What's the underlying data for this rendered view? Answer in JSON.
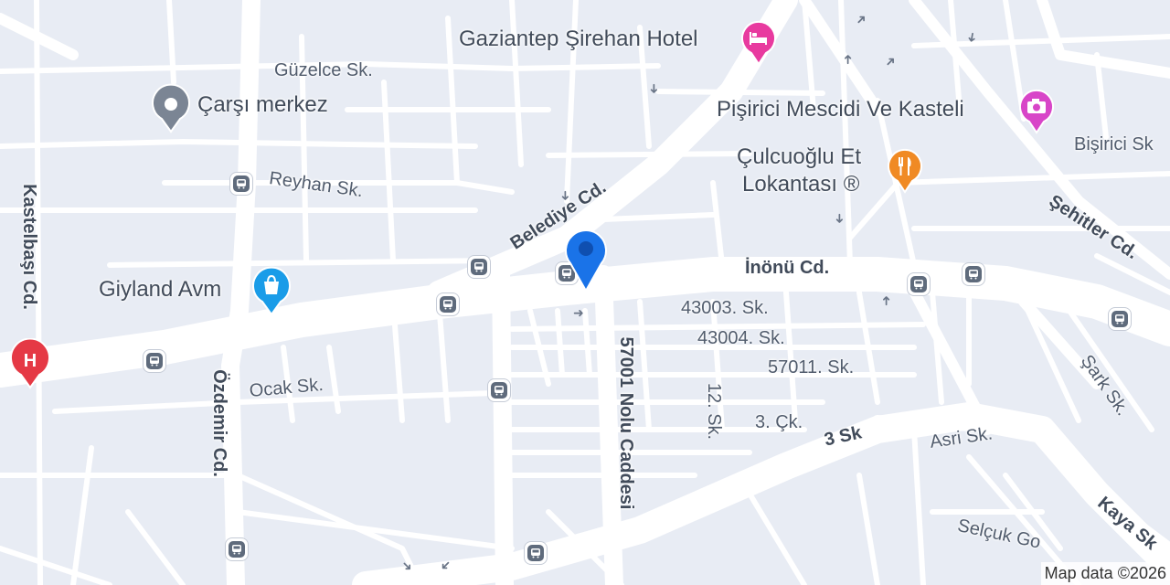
{
  "map": {
    "attribution": "Map data ©2026",
    "labels": {
      "hotel": "Gaziantep Şirehan Hotel",
      "guzelce": "Güzelce Sk.",
      "carsi": "Çarşı merkez",
      "pisirici": "Pişirici Mescidi Ve Kasteli",
      "bisirici": "Bişirici Sk",
      "culcuoglu1": "Çulcuoğlu Et",
      "culcuoglu2": "Lokantası ®",
      "reyhan": "Reyhan Sk.",
      "sehitler": "Şehitler Cd.",
      "kastelbasi": "Kastelbaşı Cd.",
      "belediye": "Belediye Cd.",
      "inonu": "İnönü Cd.",
      "giyland": "Giyland Avm",
      "sk43003": "43003. Sk.",
      "sk43004": "43004. Sk.",
      "sk57011": "57011. Sk.",
      "nolu57001": "57001 Nolu Caddesi",
      "ozdemir": "Özdemir Cd.",
      "ocak": "Ocak Sk.",
      "sk12": "12. Sk.",
      "cik3": "3. Çk.",
      "sk3": "3 Sk",
      "asri": "Asri Sk.",
      "sark": "Şark Sk.",
      "kaya": "Kaya Sk",
      "selcuk": "Selçuk Go"
    },
    "icons": {
      "hotel": "bed-icon",
      "museum": "camera-icon",
      "restaurant": "fork-knife-icon",
      "hospital": "hospital-icon",
      "shopping": "shopping-bag-icon",
      "landmark": "circle-pin-icon",
      "bus": "bus-stop-icon",
      "location": "location-pin-icon"
    },
    "colors": {
      "background": "#e8ecf4",
      "road": "#ffffff",
      "hotel": "#e83a9f",
      "museum": "#d845c8",
      "restaurant": "#f08a24",
      "hospital": "#e53945",
      "shopping": "#1a9ce8",
      "landmark": "#7b8594",
      "location": "#1a73e8"
    }
  }
}
